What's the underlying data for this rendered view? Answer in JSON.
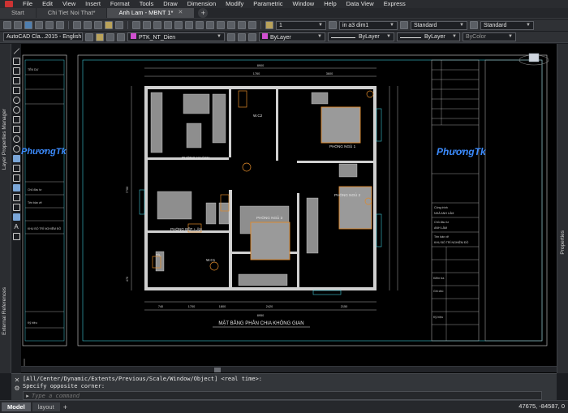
{
  "menu": {
    "items": [
      "File",
      "Edit",
      "View",
      "Insert",
      "Format",
      "Tools",
      "Draw",
      "Dimension",
      "Modify",
      "Parametric",
      "Window",
      "Help",
      "Data View",
      "Express"
    ]
  },
  "tabs": [
    {
      "label": "Start",
      "active": false
    },
    {
      "label": "Chi Tiet Noi That*",
      "active": false
    },
    {
      "label": "Anh Lam - MBNT 1*",
      "active": true
    }
  ],
  "toolbar1": {
    "scale_value": "1",
    "dimstyle": "in a3 dim1",
    "textstyle": "Standard",
    "tablestyle": "Standard"
  },
  "toolbar2": {
    "workspace": "AutoCAD Cla...2015 - English",
    "layer": "PTK_NT_Dien",
    "color": "ByLayer",
    "linetype": "ByLayer",
    "lineweight": "ByLayer",
    "plotstyle": "ByColor"
  },
  "palettes": {
    "layer_properties": "Layer Properties Manager",
    "external_references": "External References",
    "properties": "Properties"
  },
  "drawing": {
    "plan_title": "MẶT BẰNG PHÂN CHIA KHÔNG GIAN",
    "rooms": {
      "living": "PHÒNG KHÁCH",
      "wc2": "W.C2",
      "bed1": "PHÒNG NGỦ 1",
      "bed2": "PHÒNG NGỦ 2",
      "bed3": "PHÒNG NGỦ 3",
      "kitchen": "PHÒNG BẾP + ĂN",
      "wc1": "W.C1",
      "tl": "T/L"
    },
    "dims_top": {
      "overall": "8900",
      "seg1": "1760",
      "seg2": "3600"
    },
    "dims_bottom": {
      "overall": "8950",
      "seg1": "740",
      "seg2": "1700",
      "seg3": "1800",
      "seg4": "2420",
      "seg5": "2150"
    },
    "dims_left": {
      "seg1": "7700",
      "seg2": "470"
    },
    "brand_right": "PhươngTk",
    "brand_left": "PhươngTk",
    "title_block": {
      "row1": "Công trình",
      "row2": "NHÀ ANH LÂM",
      "row3": "Chủ đầu tư",
      "row4": "ANH LÂM",
      "row5": "Tên bản vẽ",
      "row6": "KHU BỐ TRÍ NGHIỆM ĐỒ",
      "label_a": "Kiểm tra",
      "label_b": "Ghi chú",
      "label_c": "Kỹ hiệu"
    },
    "left_block": {
      "row1": "TÊN DỰ",
      "row2": "Chủ đầu tư",
      "row3": "Tên bản vẽ",
      "row4": "KHU BỐ TRÍ NGHIỆM ĐỒ",
      "row5": "Kỹ hiệu"
    }
  },
  "command": {
    "history_line1": "[All/Center/Dynamic/Extents/Previous/Scale/Window/Object] <real time>:",
    "history_line2": "Specify opposite corner:",
    "placeholder": "Type a command"
  },
  "status": {
    "model_tab": "Model",
    "layout_tab": "layout",
    "coordinates": "47675, -84587, 0"
  },
  "colors": {
    "wall": "#ffffff",
    "furniture": "#c8c8c8",
    "accent_orange": "#e08a2a",
    "dimension": "#d9d9d9",
    "border_cyan": "#3fc7d6",
    "brand_blue": "#3c8cff"
  }
}
